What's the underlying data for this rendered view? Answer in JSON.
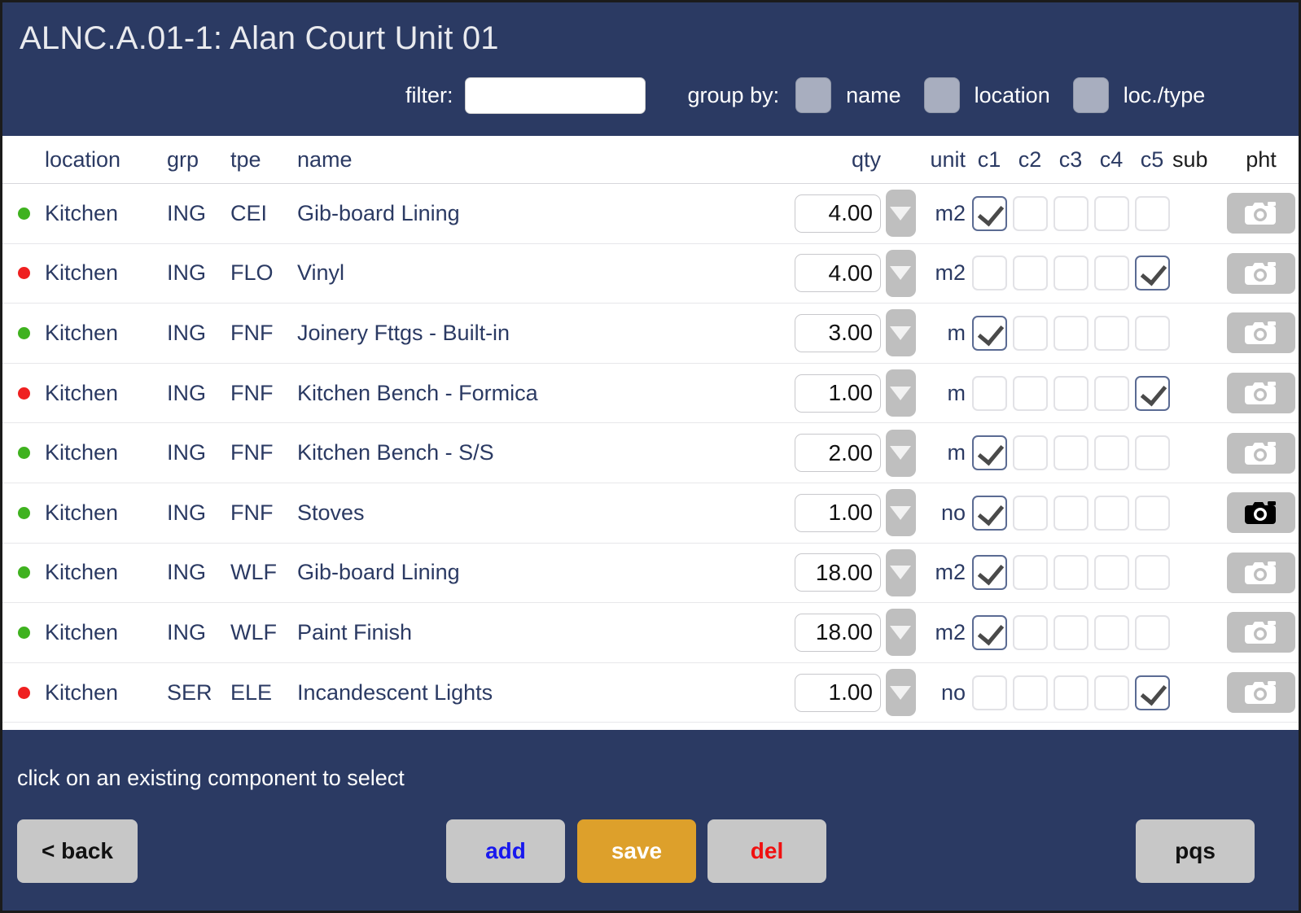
{
  "window": {
    "title": "ALNC.A.01-1: Alan Court Unit 01",
    "accent_navy": "#2b3a63",
    "accent_orange": "#dda02b",
    "status_green": "#3fb21f",
    "status_red": "#ef2020"
  },
  "header": {
    "filter_label": "filter:",
    "filter_value": "",
    "filter_placeholder": "",
    "group_by_label": "group by:",
    "group_options": [
      {
        "label": "name",
        "checked": false
      },
      {
        "label": "location",
        "checked": false
      },
      {
        "label": "loc./type",
        "checked": false
      }
    ]
  },
  "table": {
    "columns": {
      "location": "location",
      "grp": "grp",
      "tpe": "tpe",
      "name": "name",
      "qty": "qty",
      "unit": "unit",
      "c1": "c1",
      "c2": "c2",
      "c3": "c3",
      "c4": "c4",
      "c5": "c5",
      "sub": "sub",
      "pht": "pht"
    },
    "rows": [
      {
        "status": "green",
        "location": "Kitchen",
        "grp": "ING",
        "tpe": "CEI",
        "name": "Gib-board Lining",
        "qty": "4.00",
        "unit": "m2",
        "checks": [
          true,
          false,
          false,
          false,
          false
        ],
        "sub": "",
        "photo": "camera-icon",
        "has_photo": false
      },
      {
        "status": "red",
        "location": "Kitchen",
        "grp": "ING",
        "tpe": "FLO",
        "name": "Vinyl",
        "qty": "4.00",
        "unit": "m2",
        "checks": [
          false,
          false,
          false,
          false,
          true
        ],
        "sub": "",
        "photo": "camera-icon",
        "has_photo": false
      },
      {
        "status": "green",
        "location": "Kitchen",
        "grp": "ING",
        "tpe": "FNF",
        "name": "Joinery Fttgs - Built-in",
        "qty": "3.00",
        "unit": "m",
        "checks": [
          true,
          false,
          false,
          false,
          false
        ],
        "sub": "",
        "photo": "camera-icon",
        "has_photo": false
      },
      {
        "status": "red",
        "location": "Kitchen",
        "grp": "ING",
        "tpe": "FNF",
        "name": "Kitchen Bench - Formica",
        "qty": "1.00",
        "unit": "m",
        "checks": [
          false,
          false,
          false,
          false,
          true
        ],
        "sub": "",
        "photo": "camera-icon",
        "has_photo": false
      },
      {
        "status": "green",
        "location": "Kitchen",
        "grp": "ING",
        "tpe": "FNF",
        "name": "Kitchen Bench - S/S",
        "qty": "2.00",
        "unit": "m",
        "checks": [
          true,
          false,
          false,
          false,
          false
        ],
        "sub": "",
        "photo": "camera-icon",
        "has_photo": false
      },
      {
        "status": "green",
        "location": "Kitchen",
        "grp": "ING",
        "tpe": "FNF",
        "name": "Stoves",
        "qty": "1.00",
        "unit": "no",
        "checks": [
          true,
          false,
          false,
          false,
          false
        ],
        "sub": "",
        "photo": "camera-icon",
        "has_photo": true
      },
      {
        "status": "green",
        "location": "Kitchen",
        "grp": "ING",
        "tpe": "WLF",
        "name": "Gib-board Lining",
        "qty": "18.00",
        "unit": "m2",
        "checks": [
          true,
          false,
          false,
          false,
          false
        ],
        "sub": "",
        "photo": "camera-icon",
        "has_photo": false
      },
      {
        "status": "green",
        "location": "Kitchen",
        "grp": "ING",
        "tpe": "WLF",
        "name": "Paint Finish",
        "qty": "18.00",
        "unit": "m2",
        "checks": [
          true,
          false,
          false,
          false,
          false
        ],
        "sub": "",
        "photo": "camera-icon",
        "has_photo": false
      },
      {
        "status": "red",
        "location": "Kitchen",
        "grp": "SER",
        "tpe": "ELE",
        "name": "Incandescent Lights",
        "qty": "1.00",
        "unit": "no",
        "checks": [
          false,
          false,
          false,
          false,
          true
        ],
        "sub": "",
        "photo": "camera-icon",
        "has_photo": false
      }
    ]
  },
  "footer": {
    "hint": "click on an existing component to select",
    "back_label": "< back",
    "add_label": "add",
    "save_label": "save",
    "del_label": "del",
    "pqs_label": "pqs"
  }
}
